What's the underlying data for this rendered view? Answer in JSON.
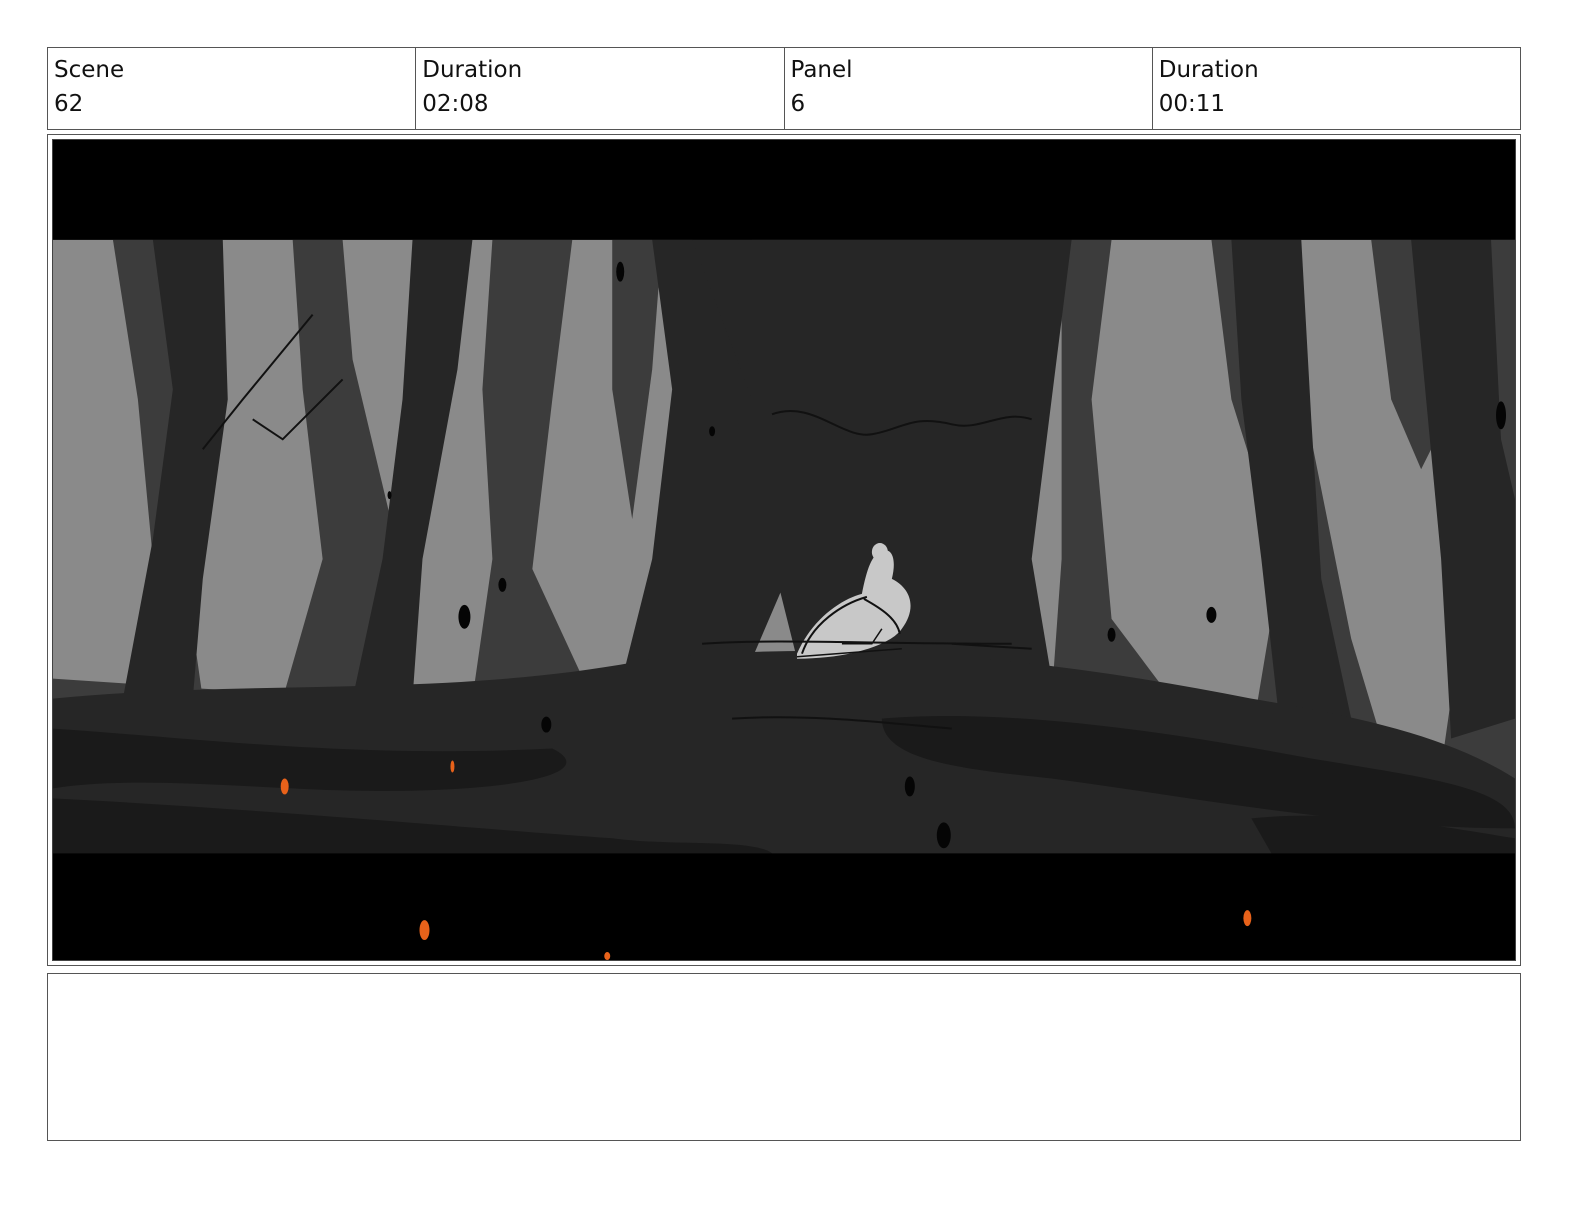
{
  "header": {
    "cells": [
      {
        "label": "Scene",
        "value": "62"
      },
      {
        "label": "Duration",
        "value": "02:08"
      },
      {
        "label": "Panel",
        "value": "6"
      },
      {
        "label": "Duration",
        "value": "00:11"
      }
    ]
  },
  "panel": {
    "colors": {
      "letterbox": "#000000",
      "sky": "#8a8a8a",
      "mid_trees": "#3c3c3c",
      "dark_trees": "#262626",
      "ground": "#2e2e2e",
      "ground_shadow": "#1a1a1a",
      "figure": "#c8c8c8",
      "ember": "#e8621a"
    }
  },
  "notes": {
    "text": ""
  }
}
